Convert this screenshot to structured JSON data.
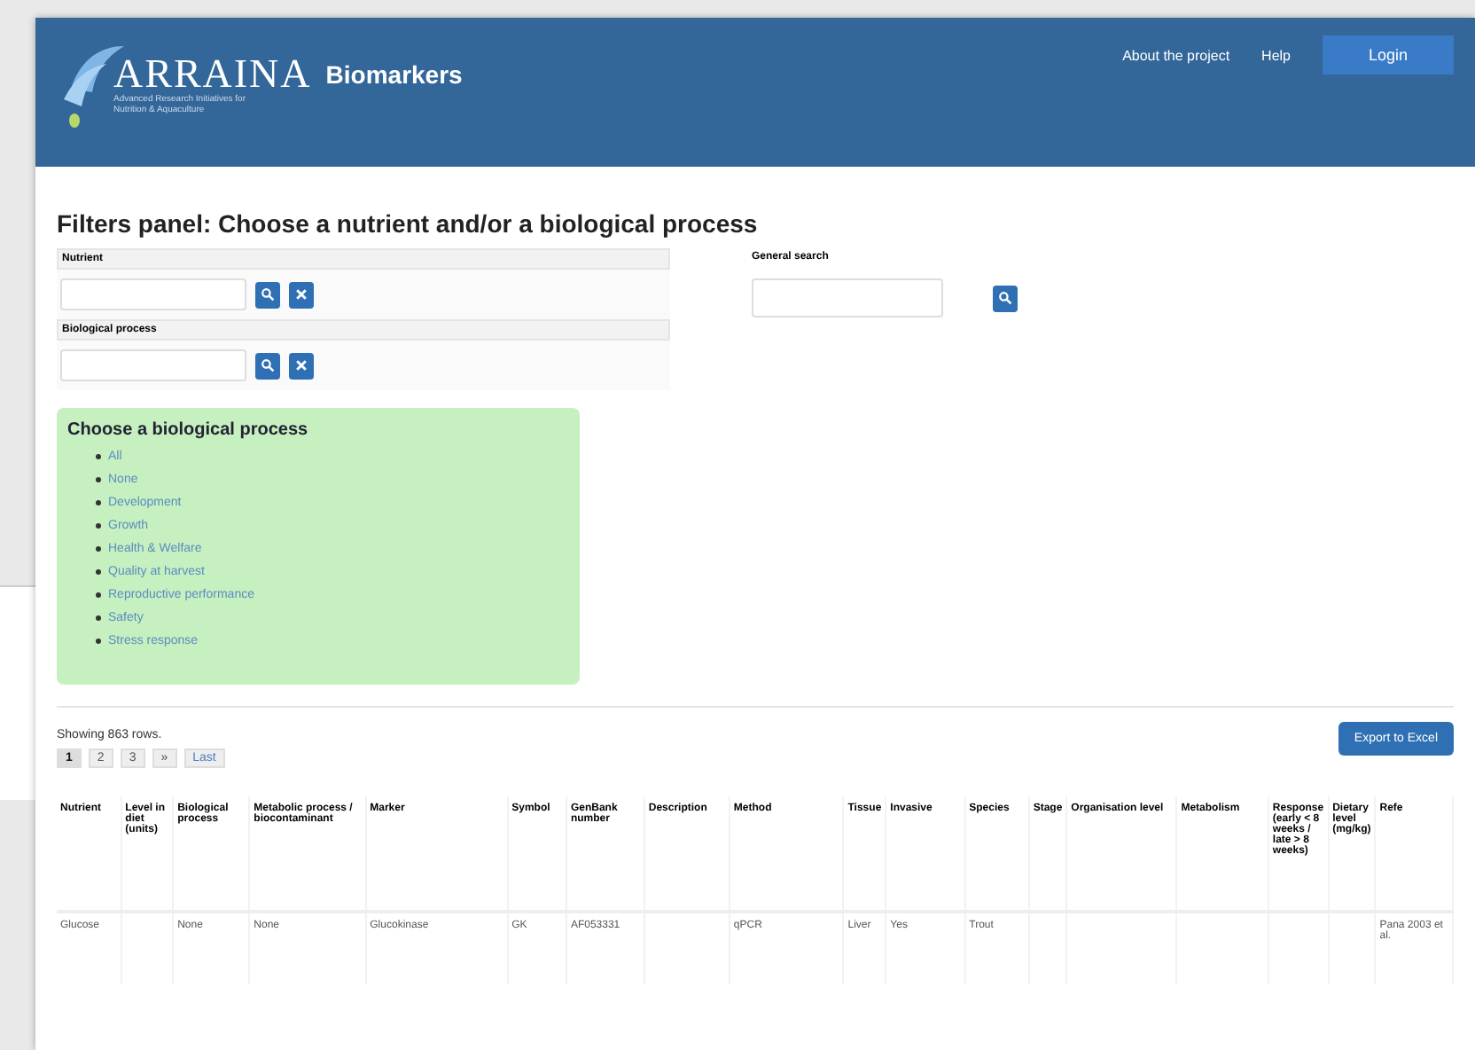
{
  "header": {
    "logo": "ARRAINA",
    "tagline": "Advanced Research Initiatives for Nutrition & Aquaculture",
    "product": "Biomarkers",
    "nav": [
      "About the project",
      "Help"
    ],
    "login": "Login"
  },
  "filters": {
    "title": "Filters panel: Choose a nutrient and/or a biological process",
    "fields": [
      {
        "label": "Nutrient"
      },
      {
        "label": "Biological process"
      }
    ],
    "general_search": {
      "label": "General search"
    }
  },
  "process_box": {
    "title": "Choose a biological process",
    "items": [
      "All",
      "None",
      "Development",
      "Growth",
      "Health & Welfare",
      "Quality at harvest",
      "Reproductive performance",
      "Safety",
      "Stress response"
    ]
  },
  "results": {
    "count": "Showing 863 rows.",
    "pages": [
      {
        "label": "1",
        "selected": true
      },
      {
        "label": "2",
        "selected": false
      },
      {
        "label": "3",
        "selected": false
      },
      {
        "label": "»",
        "selected": false
      },
      {
        "label": "Last",
        "selected": false
      }
    ],
    "export": "Export to Excel"
  },
  "table": {
    "columns": [
      "Nutrient",
      "Level in diet (units)",
      "Biological process",
      "Metabolic process / biocontaminant",
      "Marker",
      "Symbol",
      "GenBank number",
      "Description",
      "Method",
      "Tissue",
      "Invasive",
      "Species",
      "Stage",
      "Organisation level",
      "Metabolism",
      "Response (early < 8 weeks / late > 8 weeks)",
      "Dietary level (mg/kg)",
      "Refe"
    ],
    "rows": [
      [
        "Glucose",
        "",
        "None",
        "None",
        "Glucokinase",
        "GK",
        "AF053331",
        "",
        "qPCR",
        "Liver",
        "Yes",
        "Trout",
        "",
        "",
        "",
        "",
        "",
        "Pana 2003 et al."
      ]
    ]
  }
}
